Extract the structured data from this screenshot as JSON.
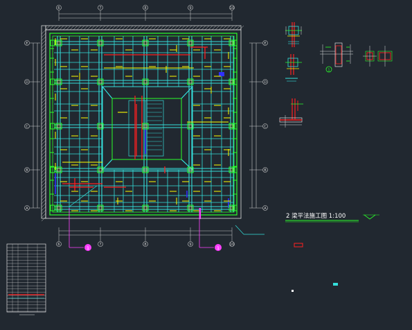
{
  "drawing": {
    "title": "2 梁平法施工图 1:100",
    "grid_top": [
      "6",
      "7",
      "8",
      "9",
      "10"
    ],
    "grid_bottom": [
      "6",
      "7",
      "8",
      "9",
      "10"
    ],
    "grid_left": [
      "E",
      "D",
      "C",
      "B",
      "A"
    ],
    "grid_right": [
      "E",
      "D",
      "C",
      "B",
      "A"
    ],
    "balloon_left": "1",
    "balloon_right": "1",
    "detail_marker": "1"
  },
  "colors": {
    "background": "#212830",
    "beam": "#35e0dc",
    "column": "#35e0dc",
    "edge": "#2aff2a",
    "rebar": "#ffff00",
    "red_beam": "#ff2020",
    "blue": "#3030ff",
    "magenta": "#ff40ff",
    "axis": "#d0d0d0",
    "title": "#ffffff"
  },
  "icons": {
    "balloon": "detail-callout-icon",
    "north": "section-marker-icon"
  }
}
